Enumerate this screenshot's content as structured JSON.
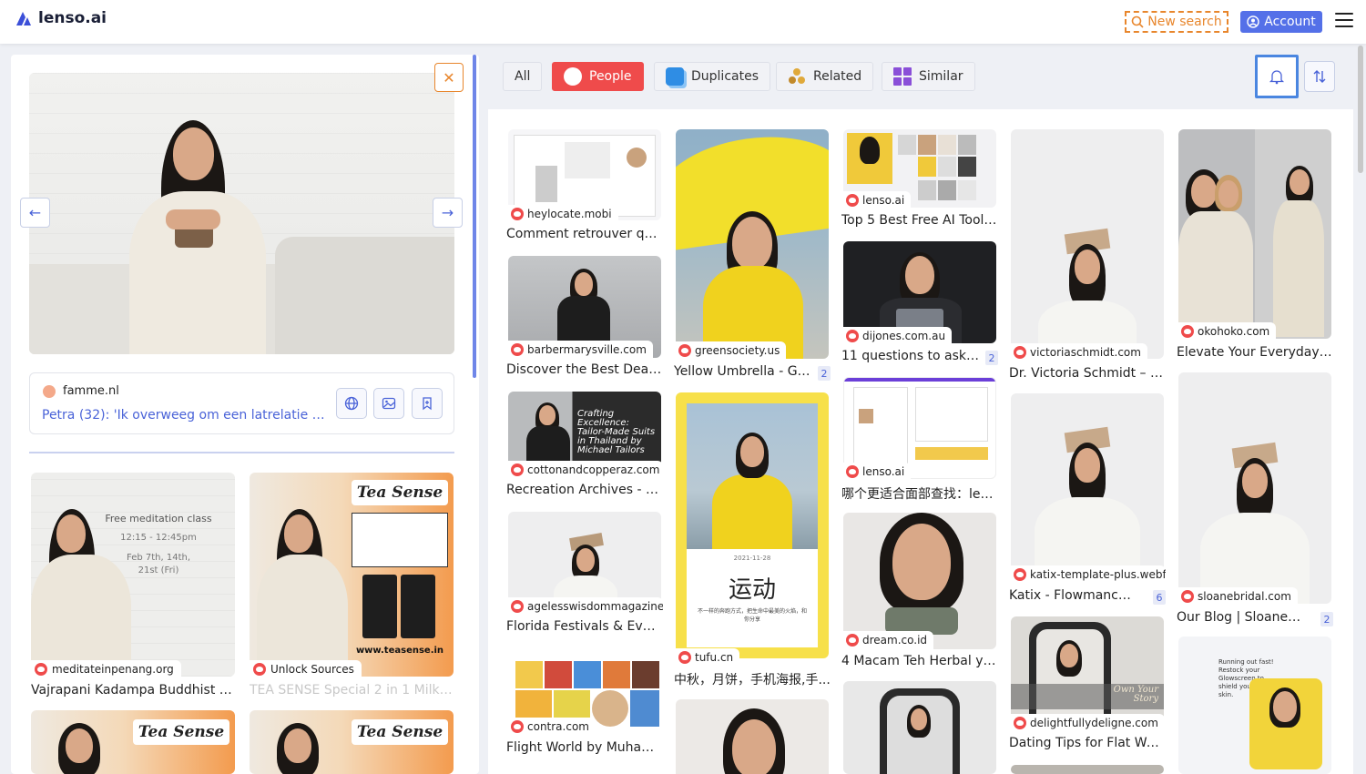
{
  "header": {
    "brand": "lenso.ai",
    "new_search": "New search",
    "account": "Account"
  },
  "left": {
    "source_site": "famme.nl",
    "source_title": "Petra (32): 'Ik overweeg om een latrelatie voor...",
    "cards": [
      {
        "site": "meditateinpenang.org",
        "title": "Vajrapani Kadampa Buddhist Ce...",
        "poster_title": "Free meditation class",
        "poster_time": "12:15 - 12:45pm",
        "poster_dates": "Feb 7th, 14th,",
        "poster_dates2": "21st (Fri)"
      },
      {
        "site": "Unlock Sources",
        "title": "TEA SENSE Special 2 in 1 Milk Tea...",
        "brand": "Tea Sense",
        "url": "www.teasense.in"
      },
      {
        "brand": "Tea Sense"
      },
      {
        "brand": "Tea Sense"
      }
    ]
  },
  "filters": {
    "all": "All",
    "people": "People",
    "duplicates": "Duplicates",
    "related": "Related",
    "similar": "Similar"
  },
  "grid": {
    "col1": [
      {
        "site": "heylocate.mobi",
        "title": "Comment retrouver que..."
      },
      {
        "site": "barbermarysville.com",
        "title": "Discover the Best Deals ..."
      },
      {
        "site": "cottonandcopperaz.com",
        "title": "Recreation Archives - Co...",
        "overlay": "Crafting Excellence: Tailor-Made Suits in Thailand by Michael Tailors"
      },
      {
        "site": "agelesswisdommagazine....",
        "title": "Florida Festivals & Event..."
      },
      {
        "site": "contra.com",
        "title": "Flight World by Muham..."
      }
    ],
    "col2": [
      {
        "site": "greensociety.us",
        "title": "Yellow Umbrella - Gre...",
        "count": "2"
      },
      {
        "site": "tufu.cn",
        "title": "中秋，月饼，手机海报,手...",
        "poster_date": "2021-11-28",
        "poster_word": "运动",
        "poster_text": "不一样的奔跑方式，把生命中最美的火焰，和你分享"
      }
    ],
    "col3": [
      {
        "site": "lenso.ai",
        "title": "Top 5 Best Free AI Tools ..."
      },
      {
        "site": "dijones.com.au",
        "title": "11 questions to ask a ...",
        "count": "2"
      },
      {
        "site": "lenso.ai",
        "title": "哪个更适合面部查找：len..."
      },
      {
        "site": "dream.co.id",
        "title": "4 Macam Teh Herbal yan..."
      }
    ],
    "col4": [
      {
        "site": "victoriaschmidt.com",
        "title": "Dr. Victoria Schmidt – Th..."
      },
      {
        "site": "katix-template-plus.webfl...",
        "title": "Katix - Flowmance+ ...",
        "count": "6"
      },
      {
        "site": "delightfullydeligne.com",
        "title": "Dating Tips for Flat Wom...",
        "overlay": "Own Your Story"
      }
    ],
    "col5": [
      {
        "site": "okohoko.com",
        "title": "Elevate Your Everyday wi..."
      },
      {
        "site": "sloanebridal.com",
        "title": "Our Blog | Sloane Bri...",
        "count": "2"
      },
      {
        "overlay": "Running out fast! Restock your Glowscreen to shield your winter skin."
      }
    ]
  },
  "colors": {
    "accent_blue": "#5470e8",
    "people_red": "#ef4b4b",
    "new_search_orange": "#e8862c"
  }
}
